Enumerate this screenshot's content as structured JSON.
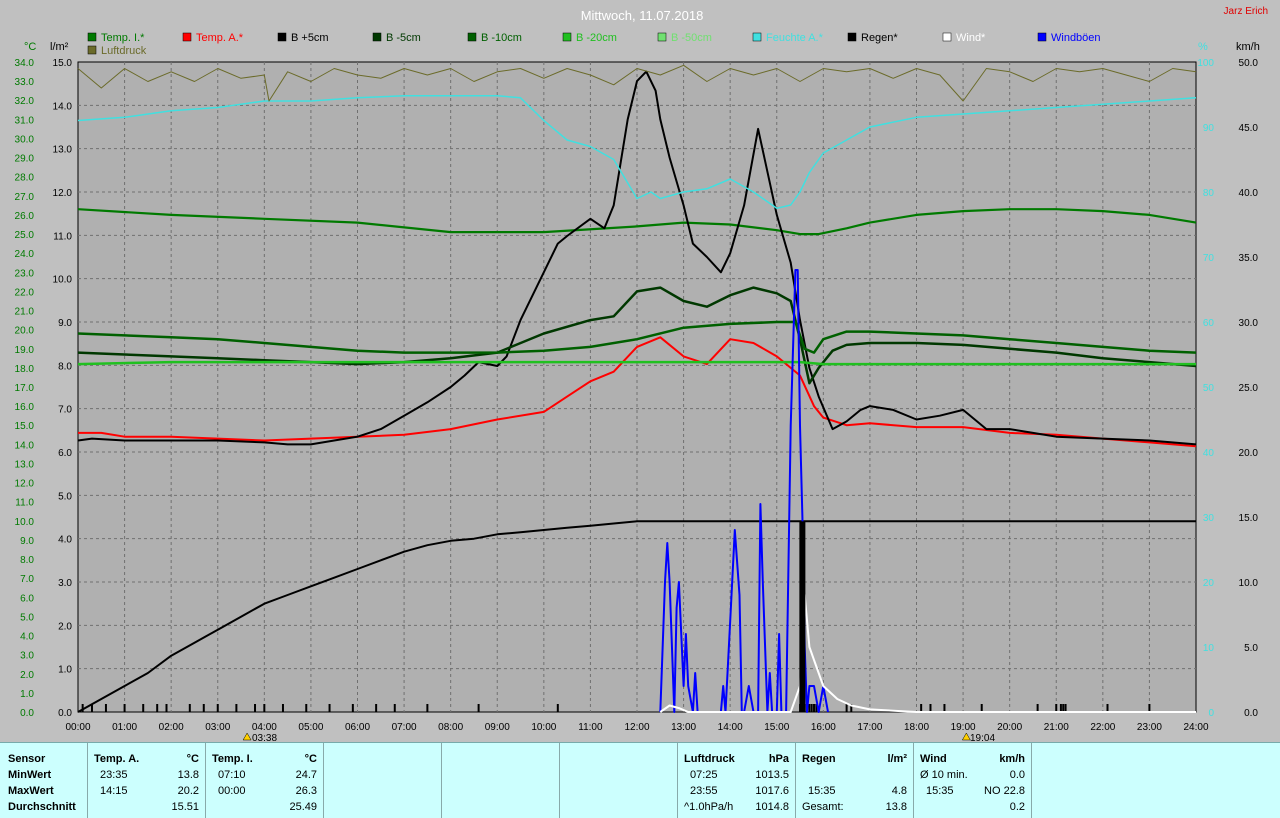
{
  "title": "Mittwoch, 11.07.2018",
  "corner_label": "Jarz Erich",
  "axis_units": {
    "left1": "°C",
    "left2": "l/m²",
    "right1": "%",
    "right2": "km/h"
  },
  "legend": [
    {
      "label": "Temp. I.*",
      "color": "#007a00"
    },
    {
      "label": "Temp. A.*",
      "color": "#ff0000"
    },
    {
      "label": "B +5cm",
      "color": "#000000"
    },
    {
      "label": "B -5cm",
      "color": "#003800"
    },
    {
      "label": "B -10cm",
      "color": "#006000"
    },
    {
      "label": "B -20cm",
      "color": "#20c020"
    },
    {
      "label": "B -50cm",
      "color": "#70e070"
    },
    {
      "label": "Feuchte A.*",
      "color": "#40e0e0"
    },
    {
      "label": "Regen*",
      "color": "#000000"
    },
    {
      "label": "Wind*",
      "color": "#ffffff"
    },
    {
      "label": "Windböen",
      "color": "#0000ff"
    },
    {
      "label": "Luftdruck",
      "color": "#6b6b2a"
    }
  ],
  "markers": {
    "sunrise": "03:38",
    "sunset": "19:04"
  },
  "chart_data": {
    "type": "line",
    "x_unit": "hour",
    "xlim": [
      0,
      24
    ],
    "x_ticks": [
      "00:00",
      "01:00",
      "02:00",
      "03:00",
      "04:00",
      "05:00",
      "06:00",
      "07:00",
      "08:00",
      "09:00",
      "10:00",
      "11:00",
      "12:00",
      "13:00",
      "14:00",
      "15:00",
      "16:00",
      "17:00",
      "18:00",
      "19:00",
      "20:00",
      "21:00",
      "22:00",
      "23:00",
      "24:00"
    ],
    "axes": {
      "temp_c": {
        "ylim": [
          0,
          34
        ],
        "ticks": [
          "0.0",
          "0.5",
          "1.0",
          "1.5",
          "2.0",
          "2.5",
          "3.0",
          "3.5",
          "4.0",
          "4.5",
          "5.0",
          "5.5",
          "6.0",
          "6.5",
          "7.0",
          "7.5",
          "8.0",
          "8.5",
          "9.0",
          "9.5",
          "10.0",
          "10.5",
          "11.0",
          "11.5",
          "12.0",
          "12.5",
          "13.0",
          "13.5",
          "14.0",
          "14.5",
          "15.0",
          "15.5",
          "16.0",
          "16.5",
          "17.0",
          "17.5",
          "18.0",
          "18.5",
          "19.0",
          "19.5",
          "20.0",
          "20.5",
          "21.0",
          "21.5",
          "22.0",
          "22.5",
          "23.0",
          "23.5",
          "24.0",
          "24.5",
          "25.0",
          "25.5",
          "26.0",
          "26.5",
          "27.0",
          "27.5",
          "28.0",
          "28.5",
          "29.0",
          "29.5",
          "30.0",
          "30.5",
          "31.0",
          "31.5",
          "32.0",
          "32.5",
          "33.0",
          "33.5",
          "34.0"
        ]
      },
      "rain_l": {
        "ylim": [
          0,
          15
        ],
        "ticks": [
          "0.0",
          "1.0",
          "2.0",
          "3.0",
          "4.0",
          "5.0",
          "6.0",
          "7.0",
          "8.0",
          "9.0",
          "10.0",
          "11.0",
          "12.0",
          "13.0",
          "14.0",
          "15.0"
        ]
      },
      "humidity_pct": {
        "ylim": [
          0,
          100
        ],
        "ticks": [
          "0",
          "10",
          "20",
          "30",
          "40",
          "50",
          "60",
          "70",
          "80",
          "90",
          "100"
        ]
      },
      "wind_kmh": {
        "ylim": [
          0,
          50
        ],
        "ticks": [
          "0.0",
          "5.0",
          "10.0",
          "15.0",
          "20.0",
          "25.0",
          "30.0",
          "35.0",
          "40.0",
          "45.0",
          "50.0"
        ]
      }
    },
    "grid": true,
    "series": [
      {
        "name": "Temp. I.*",
        "axis": "temp_c",
        "color": "#007a00",
        "width": 2.2,
        "x": [
          0,
          2,
          4,
          6,
          8,
          10,
          12,
          13,
          14,
          15,
          15.5,
          15.9,
          16.5,
          17,
          18,
          19,
          20,
          21,
          22,
          23,
          24
        ],
        "y": [
          26.3,
          26.0,
          25.8,
          25.6,
          25.1,
          25.1,
          25.4,
          25.6,
          25.5,
          25.2,
          25.0,
          25.0,
          25.3,
          25.6,
          26.0,
          26.2,
          26.3,
          26.3,
          26.2,
          26.0,
          25.6
        ]
      },
      {
        "name": "Temp. A.*",
        "axis": "temp_c",
        "color": "#ff0000",
        "width": 2,
        "x": [
          0,
          0.5,
          1,
          2,
          3,
          4,
          5,
          6,
          7,
          8,
          9,
          10,
          10.5,
          11,
          11.5,
          12,
          12.5,
          13,
          13.5,
          14,
          14.5,
          15,
          15.5,
          15.8,
          16,
          16.5,
          17,
          18,
          19,
          20,
          21,
          22,
          23,
          24
        ],
        "y": [
          14.6,
          14.6,
          14.4,
          14.4,
          14.3,
          14.2,
          14.3,
          14.4,
          14.5,
          14.8,
          15.3,
          15.7,
          16.5,
          17.3,
          17.8,
          19.1,
          19.6,
          18.6,
          18.2,
          19.5,
          19.3,
          18.6,
          17.6,
          16.0,
          15.4,
          15.0,
          15.1,
          14.9,
          14.9,
          14.6,
          14.5,
          14.3,
          14.1,
          13.9
        ]
      },
      {
        "name": "B +5cm",
        "axis": "temp_c",
        "color": "#000000",
        "width": 2,
        "x": [
          0,
          0.3,
          1,
          2,
          3,
          4,
          4.5,
          5,
          5.5,
          6,
          6.5,
          7,
          7.5,
          8,
          8.3,
          8.6,
          9,
          9.2,
          9.5,
          10,
          10.3,
          10.5,
          11,
          11.3,
          11.5,
          11.8,
          12,
          12.2,
          12.4,
          12.5,
          12.7,
          13,
          13.2,
          13.5,
          13.8,
          14,
          14.3,
          14.6,
          15,
          15.3,
          15.5,
          15.7,
          15.9,
          16.2,
          16.5,
          16.8,
          17,
          17.5,
          18,
          18.5,
          19,
          19.5,
          20,
          20.5,
          21,
          22,
          23,
          24
        ],
        "y": [
          14.2,
          14.3,
          14.2,
          14.2,
          14.2,
          14.1,
          14.0,
          14.0,
          14.2,
          14.4,
          14.8,
          15.5,
          16.2,
          17.0,
          17.6,
          18.3,
          18.1,
          18.6,
          20.5,
          23.0,
          24.5,
          24.9,
          25.8,
          25.3,
          26.5,
          31.0,
          33.0,
          33.5,
          32.5,
          31.0,
          29.0,
          26.5,
          24.5,
          23.8,
          23.0,
          24.0,
          26.5,
          30.5,
          26.0,
          23.5,
          20.5,
          18.0,
          16.5,
          14.8,
          15.2,
          15.8,
          16.0,
          15.8,
          15.3,
          15.5,
          15.8,
          14.8,
          14.8,
          14.6,
          14.4,
          14.3,
          14.2,
          14.0
        ]
      },
      {
        "name": "B -5cm",
        "axis": "temp_c",
        "color": "#003800",
        "width": 2.5,
        "x": [
          0,
          1,
          2,
          3,
          4,
          5,
          6,
          7,
          8,
          9,
          10,
          11,
          11.5,
          12,
          12.5,
          13,
          13.5,
          14,
          14.5,
          15,
          15.3,
          15.5,
          15.7,
          15.9,
          16.2,
          16.5,
          17,
          18,
          19,
          20,
          21,
          22,
          23,
          24
        ],
        "y": [
          18.8,
          18.7,
          18.6,
          18.5,
          18.4,
          18.3,
          18.2,
          18.3,
          18.5,
          18.8,
          19.8,
          20.5,
          20.7,
          22.0,
          22.2,
          21.5,
          21.2,
          21.8,
          22.2,
          21.9,
          21.5,
          19.5,
          17.2,
          18.0,
          18.9,
          19.2,
          19.3,
          19.3,
          19.2,
          19.0,
          18.8,
          18.5,
          18.3,
          18.1
        ]
      },
      {
        "name": "B -10cm",
        "axis": "temp_c",
        "color": "#006000",
        "width": 2.5,
        "x": [
          0,
          1,
          2,
          3,
          4,
          5,
          6,
          7,
          8,
          9,
          10,
          11,
          12,
          13,
          14,
          15,
          15.4,
          15.6,
          15.8,
          16,
          16.5,
          17,
          18,
          19,
          20,
          21,
          22,
          23,
          24
        ],
        "y": [
          19.8,
          19.7,
          19.6,
          19.5,
          19.3,
          19.1,
          18.9,
          18.8,
          18.8,
          18.8,
          18.9,
          19.1,
          19.5,
          20.1,
          20.3,
          20.4,
          20.4,
          19.0,
          18.8,
          19.5,
          19.9,
          19.9,
          19.8,
          19.7,
          19.5,
          19.3,
          19.1,
          18.9,
          18.8
        ]
      },
      {
        "name": "B -20cm",
        "axis": "temp_c",
        "color": "#20c020",
        "width": 2.5,
        "x": [
          0,
          2,
          4,
          6,
          8,
          10,
          12,
          14,
          15,
          15.5,
          16,
          18,
          20,
          22,
          24
        ],
        "y": [
          18.2,
          18.3,
          18.3,
          18.3,
          18.3,
          18.3,
          18.3,
          18.3,
          18.3,
          18.3,
          18.2,
          18.2,
          18.2,
          18.2,
          18.2
        ]
      },
      {
        "name": "Feuchte A.*",
        "axis": "humidity_pct",
        "color": "#40e0e0",
        "width": 1.5,
        "x": [
          0,
          1,
          2,
          3,
          4,
          5,
          6,
          7,
          8,
          9,
          9.5,
          10,
          10.5,
          11,
          11.5,
          12,
          12.3,
          12.5,
          13,
          13.5,
          14,
          14.5,
          15,
          15.3,
          15.5,
          15.7,
          16,
          16.5,
          17,
          18,
          19,
          20,
          21,
          22,
          23,
          24
        ],
        "y": [
          91,
          91.5,
          92.5,
          93,
          94,
          94,
          94.5,
          94.8,
          94.8,
          94.8,
          94.5,
          91,
          88,
          87,
          85,
          79,
          80,
          79,
          80,
          80.5,
          82,
          80,
          77.5,
          78,
          80,
          83,
          86,
          88,
          90,
          91.5,
          92,
          92.5,
          93,
          93.5,
          94,
          94.5
        ]
      },
      {
        "name": "Luftdruck",
        "axis": "humidity_pct",
        "color": "#6b6b2a",
        "width": 1,
        "x": [
          0,
          0.5,
          1,
          1.5,
          2,
          2.5,
          3,
          3.5,
          4,
          4.1,
          4.5,
          5,
          5.5,
          6,
          6.5,
          7,
          7.5,
          8,
          8.5,
          9,
          9.5,
          10,
          10.5,
          11,
          11.5,
          12,
          12.5,
          13,
          13.5,
          14,
          14.5,
          15,
          15.5,
          16,
          16.5,
          17,
          17.5,
          18,
          18.5,
          19,
          19.5,
          20,
          20.5,
          21,
          21.5,
          22,
          22.5,
          23,
          23.5,
          24
        ],
        "y": [
          99,
          96,
          99,
          97,
          98.5,
          97,
          99,
          97.5,
          98,
          94,
          98.5,
          97,
          99,
          98,
          97.5,
          99,
          98,
          99,
          97,
          98.5,
          99,
          97.5,
          99,
          98,
          96.5,
          99,
          98,
          99.5,
          97,
          99,
          98,
          99,
          97,
          99,
          98.5,
          99,
          97.5,
          99,
          98,
          94,
          99,
          98.5,
          97,
          99,
          98.5,
          99,
          98,
          97,
          99,
          98.5
        ]
      },
      {
        "name": "Regen*",
        "axis": "rain_l",
        "color": "#000000",
        "width": 2,
        "x": [
          0,
          0.5,
          1,
          1.5,
          2,
          2.5,
          3,
          3.5,
          4,
          4.5,
          5,
          5.5,
          6,
          6.5,
          7,
          7.5,
          8,
          8.5,
          9,
          9.5,
          10,
          10.5,
          11,
          11.5,
          12,
          12.5,
          13,
          13.5,
          14,
          14.5,
          15,
          15.5,
          15.55,
          15.6,
          15.7,
          15.8,
          15.9,
          16,
          24
        ],
        "y": [
          0,
          0.3,
          0.6,
          0.9,
          1.3,
          1.6,
          1.9,
          2.2,
          2.5,
          2.7,
          2.9,
          3.1,
          3.3,
          3.5,
          3.7,
          3.85,
          3.95,
          4.0,
          4.1,
          4.15,
          4.2,
          4.25,
          4.3,
          4.35,
          4.4,
          4.4,
          4.4,
          4.4,
          4.4,
          4.4,
          4.4,
          4.4,
          4.4,
          4.4,
          4.4,
          4.4,
          4.4,
          4.4,
          4.4
        ]
      },
      {
        "name": "Windböen",
        "axis": "wind_kmh",
        "color": "#0000ff",
        "width": 2,
        "x": [
          12.5,
          12.6,
          12.65,
          12.7,
          12.8,
          12.85,
          12.9,
          13,
          13.05,
          13.1,
          13.2,
          13.25,
          13.3,
          13.4,
          13.8,
          13.85,
          13.9,
          14,
          14.1,
          14.2,
          14.25,
          14.3,
          14.4,
          14.5,
          14.6,
          14.65,
          14.7,
          14.8,
          14.85,
          14.9,
          15.0,
          15.05,
          15.1,
          15.2,
          15.3,
          15.4,
          15.45,
          15.5,
          15.55,
          15.6,
          15.65,
          15.7,
          15.8,
          15.9,
          16,
          16.1
        ],
        "y": [
          0,
          10,
          13,
          10,
          0,
          8,
          10,
          2,
          6,
          2,
          0,
          3,
          0,
          0,
          0,
          2,
          0,
          7,
          14,
          9,
          0,
          0,
          2,
          0,
          0,
          16,
          10,
          0,
          3,
          0,
          0,
          6,
          0,
          0,
          22,
          34,
          34,
          22,
          15,
          5,
          0,
          2,
          2,
          0,
          2,
          0
        ]
      },
      {
        "name": "Wind*",
        "axis": "wind_kmh",
        "color": "#ffffff",
        "width": 2,
        "x": [
          12.5,
          12.7,
          12.9,
          13.1,
          15.3,
          15.5,
          15.6,
          15.7,
          15.8,
          16,
          16.3,
          16.6,
          17,
          18,
          24
        ],
        "y": [
          0,
          0.5,
          0.3,
          0,
          0,
          2,
          9,
          5,
          4,
          2,
          1,
          0.5,
          0.2,
          0,
          0
        ]
      }
    ],
    "rain_events": [
      0.1,
      0.3,
      0.6,
      1.0,
      1.4,
      1.7,
      1.9,
      2.4,
      2.7,
      3.0,
      3.4,
      3.8,
      4.0,
      4.4,
      4.9,
      5.4,
      5.9,
      6.4,
      6.8,
      7.5,
      8.6,
      10.3,
      15.5,
      15.55,
      15.6,
      15.65,
      15.7,
      15.75,
      15.8,
      15.85,
      16.5,
      16.6,
      18.1,
      18.3,
      18.6,
      19.4,
      20.6,
      21.0,
      21.1,
      21.15,
      21.2,
      22.1,
      23.0
    ]
  },
  "stats": {
    "sensor_header": "Sensor",
    "row_labels": [
      "MinWert",
      "MaxWert",
      "Durchschnitt"
    ],
    "temp_a": {
      "title": "Temp. A.",
      "unit": "°C",
      "rows": [
        [
          "23:35",
          "13.8"
        ],
        [
          "14:15",
          "20.2"
        ],
        [
          "",
          "15.51"
        ]
      ]
    },
    "temp_i": {
      "title": "Temp. I.",
      "unit": "°C",
      "rows": [
        [
          "07:10",
          "24.7"
        ],
        [
          "00:00",
          "26.3"
        ],
        [
          "",
          "25.49"
        ]
      ]
    },
    "pressure": {
      "title": "Luftdruck",
      "unit": "hPa",
      "rows": [
        [
          "07:25",
          "1013.5"
        ],
        [
          "23:55",
          "1017.6"
        ],
        [
          "^1.0hPa/h",
          "1014.8"
        ]
      ]
    },
    "rain": {
      "title": "Regen",
      "unit": "l/m²",
      "rows": [
        [
          "",
          ""
        ],
        [
          "15:35",
          "4.8"
        ],
        [
          "Gesamt:",
          "13.8"
        ]
      ]
    },
    "wind": {
      "title": "Wind",
      "unit": "km/h",
      "rows": [
        [
          "Ø 10 min.",
          "0.0"
        ],
        [
          "15:35",
          "NO 22.8"
        ],
        [
          "",
          "0.2"
        ]
      ]
    }
  }
}
